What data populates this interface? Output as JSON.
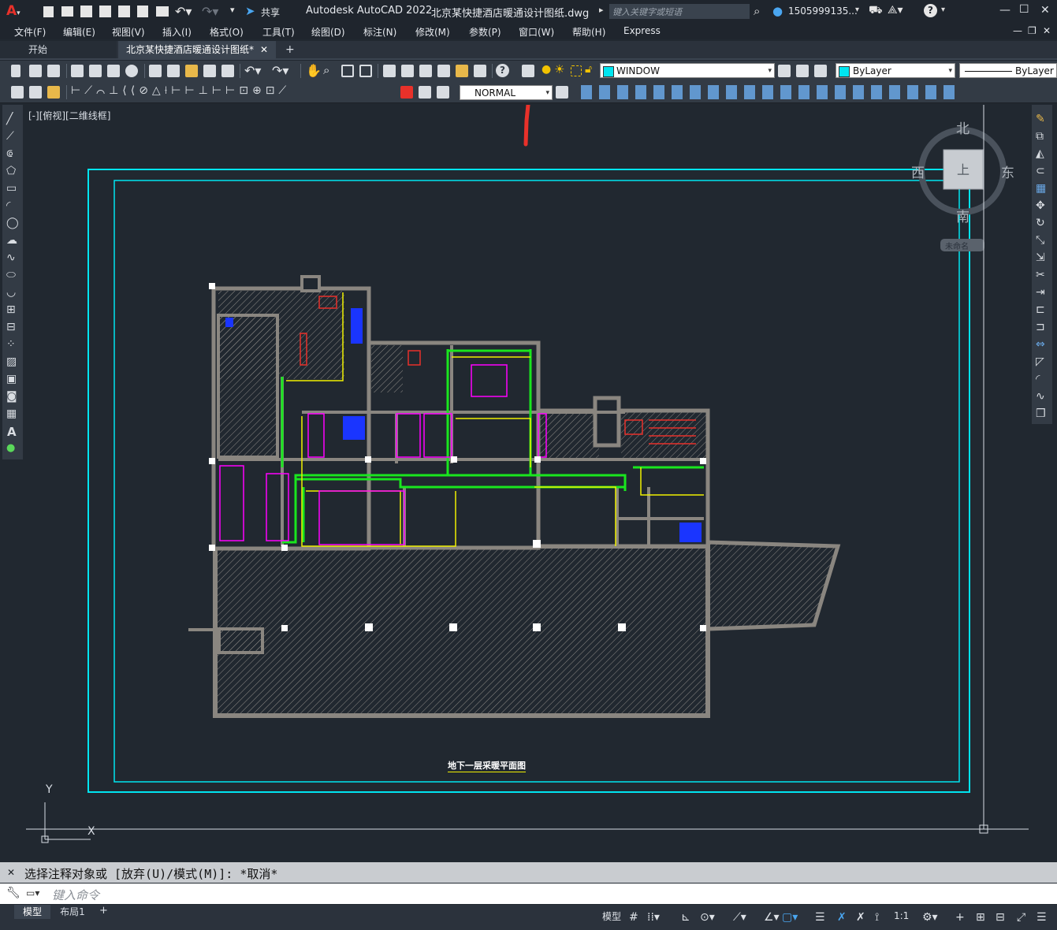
{
  "title_bar": {
    "app_title": "Autodesk AutoCAD 2022",
    "file_name": "北京某快捷酒店暖通设计图纸.dwg",
    "share_label": "共享",
    "search_placeholder": "键入关键字或短语",
    "user_name": "1505999135...",
    "min": "—",
    "max": "☐",
    "close": "✕"
  },
  "menu": {
    "items": [
      "文件(F)",
      "编辑(E)",
      "视图(V)",
      "插入(I)",
      "格式(O)",
      "工具(T)",
      "绘图(D)",
      "标注(N)",
      "修改(M)",
      "参数(P)",
      "窗口(W)",
      "帮助(H)",
      "Express"
    ]
  },
  "tabs": {
    "start": "开始",
    "doc": "北京某快捷酒店暖通设计图纸*",
    "close": "✕",
    "add": "+"
  },
  "toolbar": {
    "layer_name": "WINDOW",
    "color_value": "ByLayer",
    "linetype_value": "ByLayer",
    "text_style": "NORMAL"
  },
  "viewport": {
    "view_label": "[-][俯视][二维线框]",
    "drawing_title": "地下一层采暖平面图",
    "ucs_y": "Y",
    "ucs_x": "X"
  },
  "viewcube": {
    "north": "北",
    "south": "南",
    "east": "东",
    "west": "西",
    "top": "上",
    "wcs": "未命名"
  },
  "command": {
    "history": "选择注释对象或 [放弃(U)/模式(M)]: *取消*",
    "prompt_placeholder": "键入命令"
  },
  "status": {
    "model_tab": "模型",
    "layout_tab": "布局1",
    "add": "+",
    "model_space": "模型",
    "scale": "1:1"
  },
  "colors": {
    "background": "#212830",
    "frame": "#00e5f0",
    "wall": "#8a8680",
    "pipe_green": "#19e61e",
    "yellow": "#f0f000",
    "magenta": "#ff00ff",
    "blue": "#1a35ff",
    "red_accent": "#e8312a"
  }
}
